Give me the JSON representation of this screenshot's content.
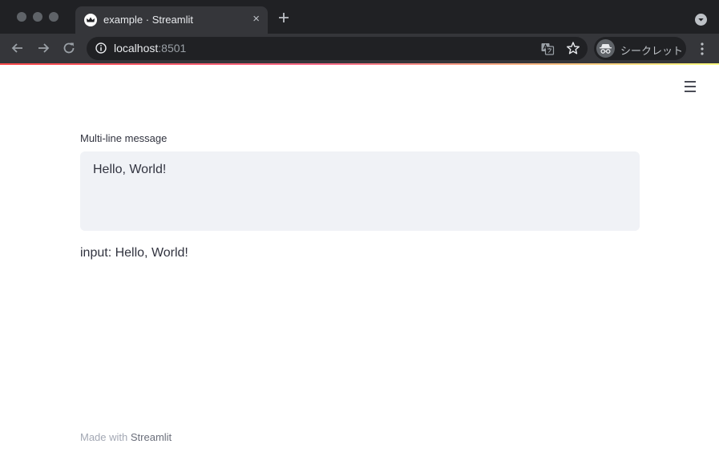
{
  "browser": {
    "tab_title": "example · Streamlit",
    "tab_close": "×",
    "url_host": "localhost",
    "url_port": ":8501",
    "incognito_label": "シークレット"
  },
  "app": {
    "textarea_label": "Multi-line message",
    "textarea_value": "Hello, World!",
    "output_text": "input: Hello, World!"
  },
  "footer": {
    "prefix": "Made with ",
    "link": "Streamlit"
  },
  "colors": {
    "accent_red": "#ff4b4b",
    "input_bg": "#f0f2f6",
    "text": "#31333f"
  }
}
